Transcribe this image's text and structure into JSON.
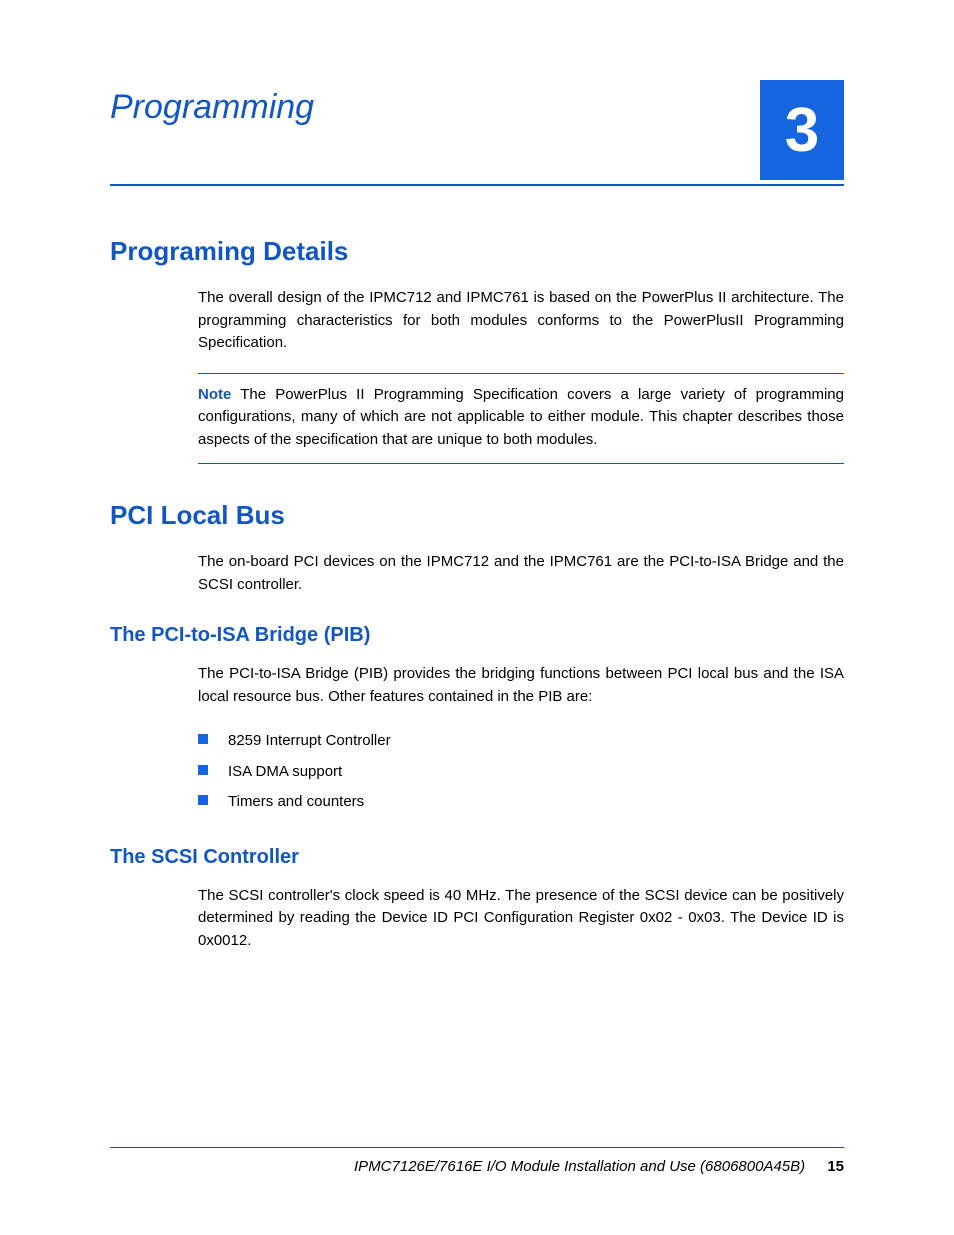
{
  "chapter": {
    "title": "Programming",
    "number": "3"
  },
  "sections": {
    "programming_details": {
      "heading": "Programing Details",
      "para1": "The overall design of the IPMC712 and IPMC761 is based on the PowerPlus II architecture. The programming characteristics for both modules conforms to the PowerPlusII Programming Specification.",
      "note_label": "Note",
      "note_text": "  The PowerPlus II Programming Specification covers a large variety of programming configurations, many of which are not applicable to either module. This chapter describes those aspects of the specification that are unique to both modules."
    },
    "pci_local_bus": {
      "heading": "PCI Local Bus",
      "para1": "The on-board PCI devices on the IPMC712 and the IPMC761 are the PCI-to-ISA Bridge and the SCSI controller.",
      "pib": {
        "heading": "The PCI-to-ISA Bridge (PIB)",
        "para1": "The PCI-to-ISA Bridge (PIB) provides the bridging functions between PCI local bus and the ISA local resource bus. Other features contained in the PIB are:",
        "bullets": {
          "0": "8259 Interrupt Controller",
          "1": "ISA DMA support",
          "2": "Timers and counters"
        }
      },
      "scsi": {
        "heading": "The SCSI Controller",
        "para1": "The SCSI controller's clock speed is 40 MHz. The presence of the SCSI device can be positively determined by reading the Device ID PCI Configuration Register 0x02 - 0x03. The Device ID is 0x0012."
      }
    }
  },
  "footer": {
    "doc": "IPMC7126E/7616E I/O Module Installation and Use (6806800A45B)",
    "page": "15"
  }
}
